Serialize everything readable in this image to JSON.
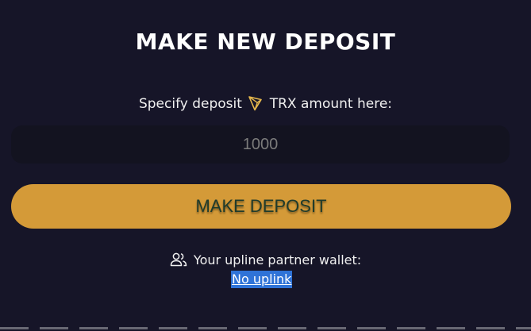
{
  "deposit": {
    "title": "MAKE NEW DEPOSIT",
    "specify_prefix": "Specify deposit",
    "specify_suffix": "TRX amount here:",
    "amount_placeholder": "1000",
    "button_label": "MAKE DEPOSIT",
    "icon_currency": "tron-icon"
  },
  "upline": {
    "label": "Your upline partner wallet:",
    "link_text": "No uplink",
    "icon": "users-icon"
  },
  "colors": {
    "background": "#161528",
    "input_background": "#131320",
    "button": "#d49a38",
    "button_text": "#1f3b2b",
    "tron_icon": "#e6b84d",
    "link_highlight": "#2f73d7"
  }
}
